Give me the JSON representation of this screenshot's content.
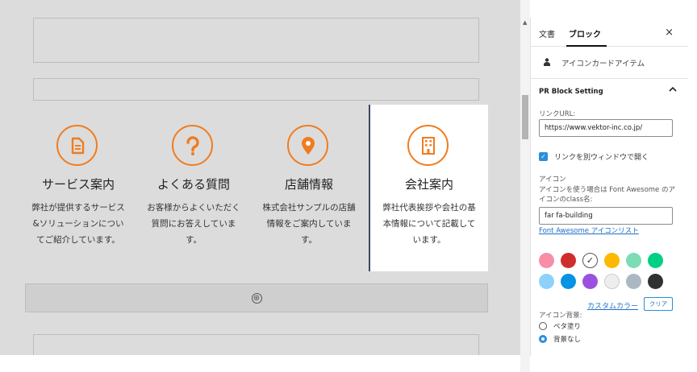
{
  "cards": [
    {
      "title": "サービス案内",
      "desc": [
        "弊社が提供するサービス",
        "&ソリューションについ",
        "てご紹介しています。"
      ],
      "icon": "document-icon"
    },
    {
      "title": "よくある質問",
      "desc": [
        "お客様からよくいただく",
        "質問にお答えしていま",
        "す。"
      ],
      "icon": "question-icon"
    },
    {
      "title": "店舗情報",
      "desc": [
        "株式会社サンプルの店舗",
        "情報をご案内していま",
        "す。"
      ],
      "icon": "map-pin-icon"
    },
    {
      "title": "会社案内",
      "desc": [
        "弊社代表挨拶や会社の基",
        "本情報について記載して",
        "います。"
      ],
      "icon": "building-icon"
    }
  ],
  "editor": {
    "add_symbol": "⊕"
  },
  "sidebar": {
    "tabs": [
      "文書",
      "ブロック"
    ],
    "active_tab": "ブロック",
    "close_symbol": "×",
    "block_name": "アイコンカードアイテム",
    "panel_title": "PR Block Setting",
    "link_url_label": "リンクURL:",
    "link_url_value": "https://www.vektor-inc.co.jp/",
    "new_window_label": "リンクを別ウィンドウで開く",
    "new_window_checked": true,
    "icon_label": "アイコン",
    "icon_help": [
      "アイコンを使う場合は Font Awesome のア",
      "イコンのclass名:"
    ],
    "icon_class_value": "far fa-building",
    "icon_list_link": "Font Awesome アイコンリスト",
    "colors": [
      "#f78da7",
      "#cf2e2e",
      "#ffffff",
      "#fcb900",
      "#7bdcb5",
      "#00d084",
      "#8ed1fc",
      "#0693e3",
      "#9b51e0",
      "#eeeeee",
      "#abb8c3",
      "#313131"
    ],
    "selected_color_index": 2,
    "custom_color_link": "カスタムカラー",
    "clear_button": "クリア",
    "icon_bg_label": "アイコン背景:",
    "icon_bg_options": [
      "ベタ塗り",
      "背景なし"
    ],
    "icon_bg_selected": "背景なし"
  },
  "accent_color": "#f07c1f"
}
